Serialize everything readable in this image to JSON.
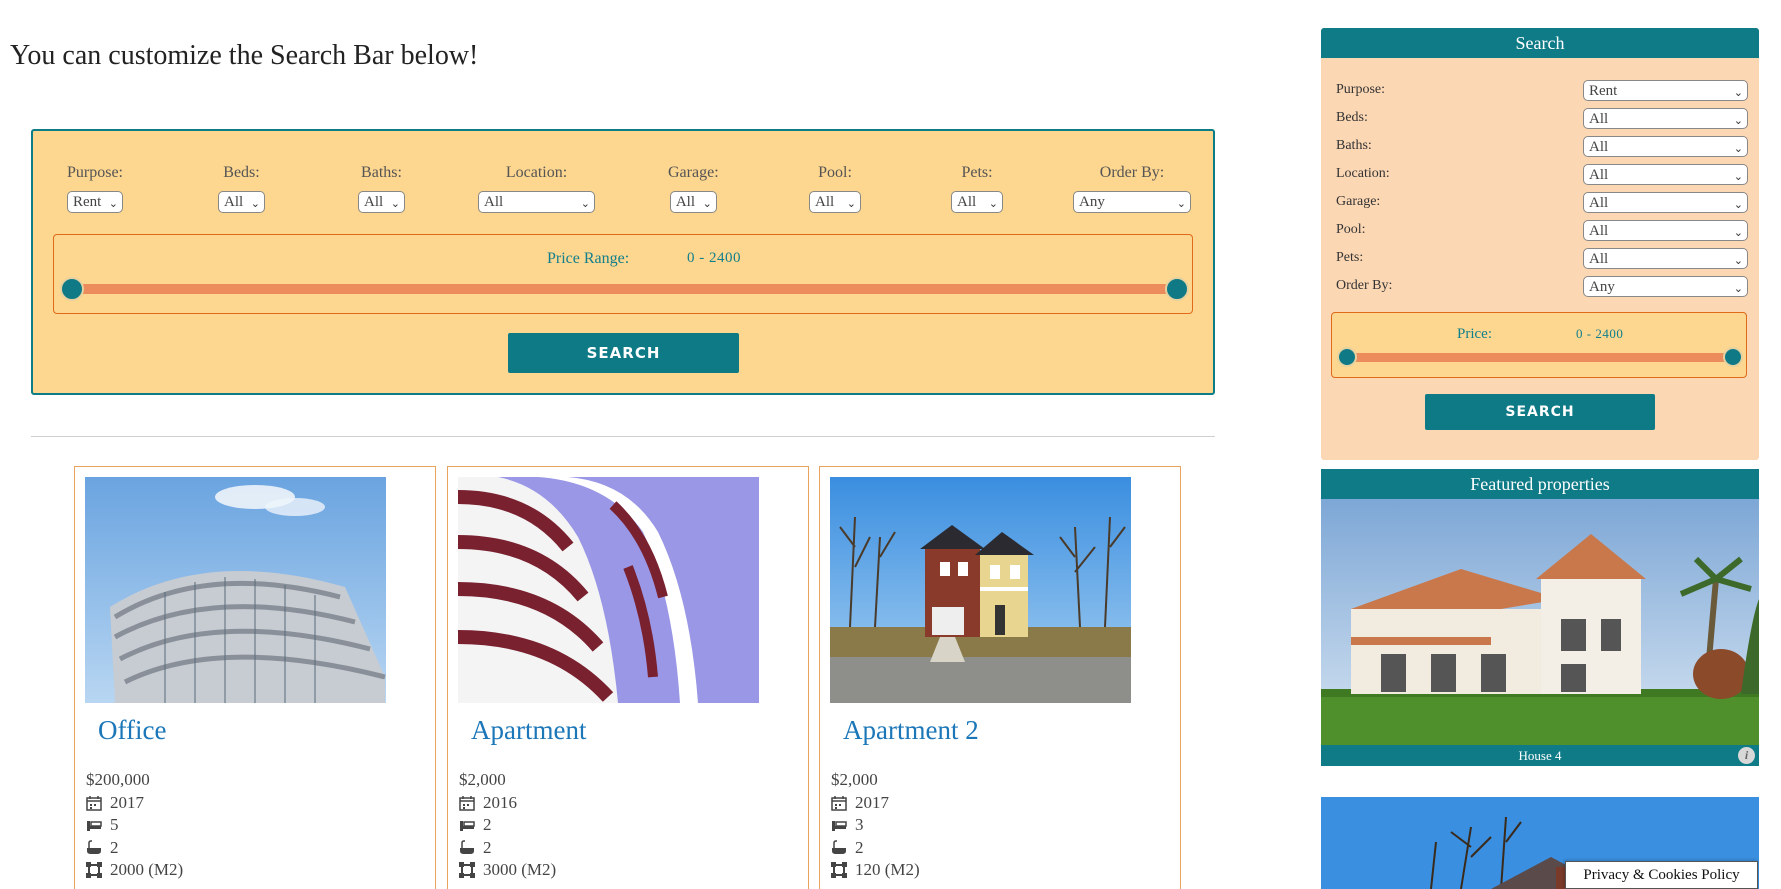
{
  "heading": "You can customize the Search Bar below!",
  "search_bar": {
    "fields": [
      {
        "label": "Purpose:",
        "value": "Rent"
      },
      {
        "label": "Beds:",
        "value": "All"
      },
      {
        "label": "Baths:",
        "value": "All"
      },
      {
        "label": "Location:",
        "value": "All"
      },
      {
        "label": "Garage:",
        "value": "All"
      },
      {
        "label": "Pool:",
        "value": "All"
      },
      {
        "label": "Pets:",
        "value": "All"
      },
      {
        "label": "Order By:",
        "value": "Any"
      }
    ],
    "price_label": "Price Range:",
    "price_value": "0 - 2400",
    "button": "SEARCH"
  },
  "properties": [
    {
      "title": "Office",
      "price": "$200,000",
      "year": "2017",
      "beds": "5",
      "baths": "2",
      "area": "2000  (M2)"
    },
    {
      "title": "Apartment",
      "price": "$2,000",
      "year": "2016",
      "beds": "2",
      "baths": "2",
      "area": "3000  (M2)"
    },
    {
      "title": "Apartment 2",
      "price": "$2,000",
      "year": "2017",
      "beds": "3",
      "baths": "2",
      "area": "120  (M2)"
    }
  ],
  "sidebar": {
    "title": "Search",
    "fields": [
      {
        "label": "Purpose:",
        "value": "Rent"
      },
      {
        "label": "Beds:",
        "value": "All"
      },
      {
        "label": "Baths:",
        "value": "All"
      },
      {
        "label": "Location:",
        "value": "All"
      },
      {
        "label": "Garage:",
        "value": "All"
      },
      {
        "label": "Pool:",
        "value": "All"
      },
      {
        "label": "Pets:",
        "value": "All"
      },
      {
        "label": "Order By:",
        "value": "Any"
      }
    ],
    "price_label": "Price:",
    "price_value": "0 - 2400",
    "button": "SEARCH"
  },
  "featured": {
    "title": "Featured properties",
    "caption": "House 4",
    "info_icon": "i"
  },
  "cookie_notice": "Privacy & Cookies Policy",
  "icons": {
    "year": "calendar-icon",
    "beds": "bed-icon",
    "baths": "bath-icon",
    "area": "area-icon",
    "dropdown": "chevron-down-icon"
  },
  "colors": {
    "teal": "#0f7b87",
    "search_bg": "#fdd68f",
    "sidebar_bg": "#fcd7b4",
    "slider_track": "#ec8b5c",
    "title_blue": "#1b77b8"
  }
}
